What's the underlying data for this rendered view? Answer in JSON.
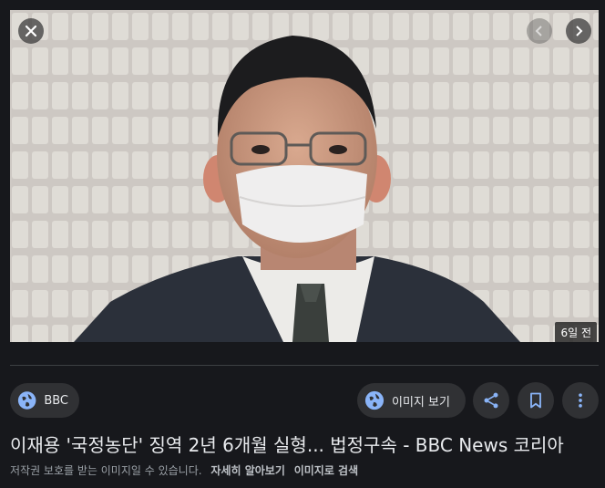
{
  "image": {
    "alt": "",
    "age_badge": "6일 전"
  },
  "source": {
    "label": "BBC",
    "icon": "globe-icon"
  },
  "actions": {
    "visit_label": "이미지 보기",
    "share_icon": "share-icon",
    "save_icon": "bookmark-icon",
    "more_icon": "more-vert-icon"
  },
  "title": "이재용 '국정농단' 징역 2년 6개월 실형... 법정구속 - BBC News 코리아",
  "footer": {
    "notice": "저작권 보호를 받는 이미지일 수 있습니다.",
    "learn_more": "자세히 알아보기",
    "search_by_image": "이미지로 검색"
  },
  "colors": {
    "background": "#17181c",
    "chip": "#303134",
    "accent_blue": "#8ab4f8"
  }
}
